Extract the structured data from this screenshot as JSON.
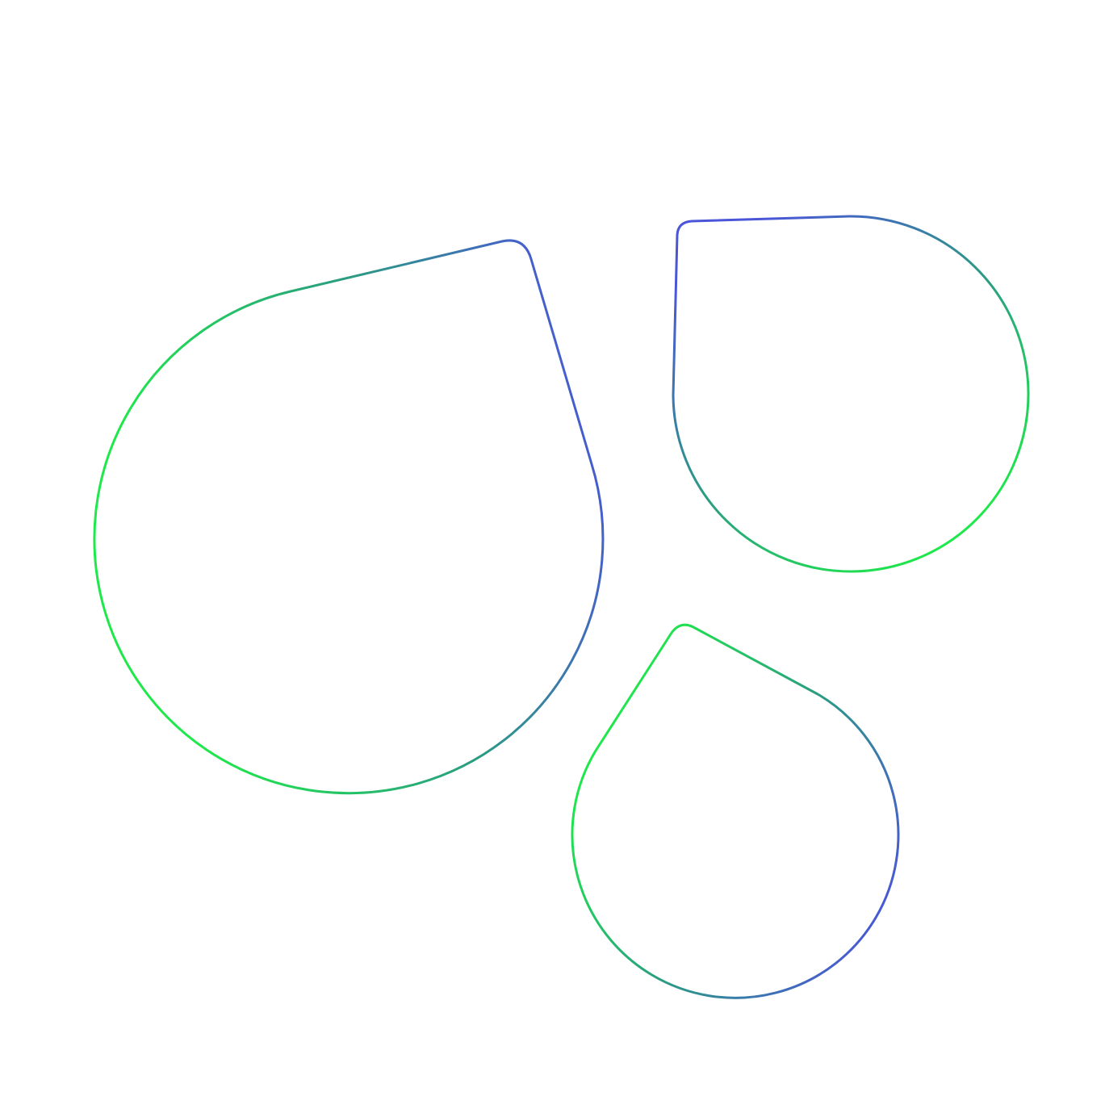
{
  "illustration": {
    "shapes": [
      "droplet",
      "droplet",
      "droplet"
    ],
    "colors": {
      "background": "#ffffff",
      "gradient_green": "#1ee84a",
      "gradient_teal": "#2b9c82",
      "gradient_blue": "#4a55d8"
    }
  }
}
